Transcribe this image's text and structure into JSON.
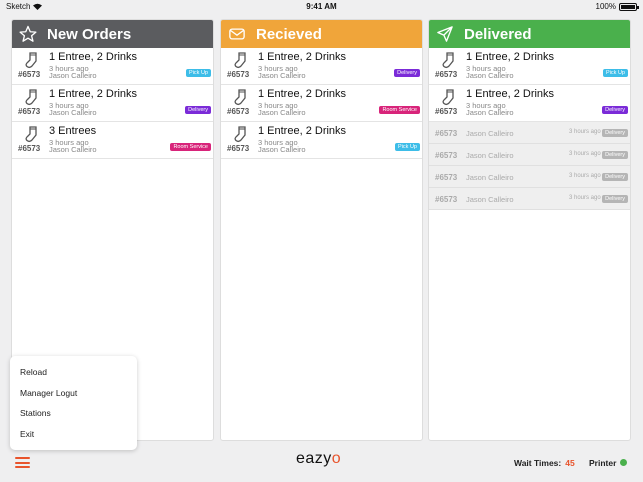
{
  "status_bar": {
    "carrier": "Sketch",
    "time": "9:41 AM",
    "battery": "100%"
  },
  "columns": {
    "new": {
      "title": "New Orders",
      "icon": "star-icon",
      "orders": [
        {
          "number": "#6573",
          "title": "1 Entree, 2 Drinks",
          "time": "3 hours ago",
          "customer": "Jason Calleiro",
          "type": "Pick Up"
        },
        {
          "number": "#6573",
          "title": "1 Entree, 2 Drinks",
          "time": "3 hours ago",
          "customer": "Jason Calleiro",
          "type": "Delivery"
        },
        {
          "number": "#6573",
          "title": "3 Entrees",
          "time": "3 hours ago",
          "customer": "Jason Calleiro",
          "type": "Room Service"
        }
      ]
    },
    "received": {
      "title": "Recieved",
      "icon": "envelope-icon",
      "orders": [
        {
          "number": "#6573",
          "title": "1 Entree, 2 Drinks",
          "time": "3 hours ago",
          "customer": "Jason Calleiro",
          "type": "Delivery"
        },
        {
          "number": "#6573",
          "title": "1 Entree, 2 Drinks",
          "time": "3 hours ago",
          "customer": "Jason Calleiro",
          "type": "Room Service"
        },
        {
          "number": "#6573",
          "title": "1 Entree, 2 Drinks",
          "time": "3 hours ago",
          "customer": "Jason Calleiro",
          "type": "Pick Up"
        }
      ]
    },
    "delivered": {
      "title": "Delivered",
      "icon": "paper-plane-icon",
      "orders": [
        {
          "number": "#6573",
          "title": "1 Entree, 2 Drinks",
          "time": "3 hours ago",
          "customer": "Jason Calleiro",
          "type": "Pick Up"
        },
        {
          "number": "#6573",
          "title": "1 Entree, 2 Drinks",
          "time": "3 hours ago",
          "customer": "Jason Calleiro",
          "type": "Delivery"
        }
      ],
      "completed": [
        {
          "number": "#6573",
          "customer": "Jason Calleiro",
          "time": "3 hours ago",
          "type": "Delivery"
        },
        {
          "number": "#6573",
          "customer": "Jason Calleiro",
          "time": "3 hours ago",
          "type": "Delivery"
        },
        {
          "number": "#6573",
          "customer": "Jason Calleiro",
          "time": "3 hours ago",
          "type": "Delivery"
        },
        {
          "number": "#6573",
          "customer": "Jason Calleiro",
          "time": "3 hours ago",
          "type": "Delivery"
        }
      ]
    }
  },
  "menu": {
    "items": [
      "Reload",
      "Manager Logut",
      "Stations",
      "Exit"
    ]
  },
  "footer": {
    "logo_text": "eazy",
    "logo_accent": "o",
    "wait_label": "Wait Times:",
    "wait_value": "45",
    "printer_label": "Printer",
    "printer_status_color": "#4ab04c"
  },
  "colors": {
    "new_header": "#5b5c5f",
    "received_header": "#f0a53a",
    "delivered_header": "#4ab04c",
    "accent": "#e8542c",
    "pickup_badge": "#3dbde8",
    "delivery_badge": "#7b2bd8",
    "room_service_badge": "#d8247a"
  }
}
